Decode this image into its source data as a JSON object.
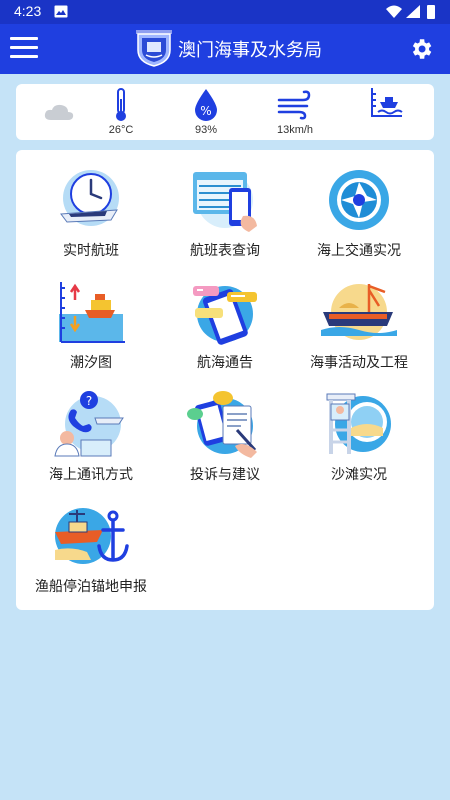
{
  "status_bar": {
    "time": "4:23"
  },
  "app_bar": {
    "title": "澳门海事及水务局"
  },
  "weather": {
    "temperature": "26°C",
    "humidity": "93%",
    "wind": "13km/h",
    "tide": ""
  },
  "menu": {
    "items": [
      {
        "label": "实时航班",
        "icon": "ferry-clock-icon"
      },
      {
        "label": "航班表查询",
        "icon": "timetable-phone-icon"
      },
      {
        "label": "海上交通实况",
        "icon": "camera-lens-icon"
      },
      {
        "label": "潮汐图",
        "icon": "tide-chart-icon"
      },
      {
        "label": "航海通告",
        "icon": "notice-phone-icon"
      },
      {
        "label": "海事活动及工程",
        "icon": "marine-works-icon"
      },
      {
        "label": "海上通讯方式",
        "icon": "communication-icon"
      },
      {
        "label": "投诉与建议",
        "icon": "complaint-suggestion-icon"
      },
      {
        "label": "沙滩实况",
        "icon": "beach-camera-icon"
      },
      {
        "label": "渔船停泊锚地申报",
        "icon": "fishing-boat-anchor-icon"
      }
    ]
  },
  "colors": {
    "status_bar": "#1a34c6",
    "app_bar": "#1f3fe0",
    "background": "#c5e3f7",
    "card": "#ffffff"
  }
}
